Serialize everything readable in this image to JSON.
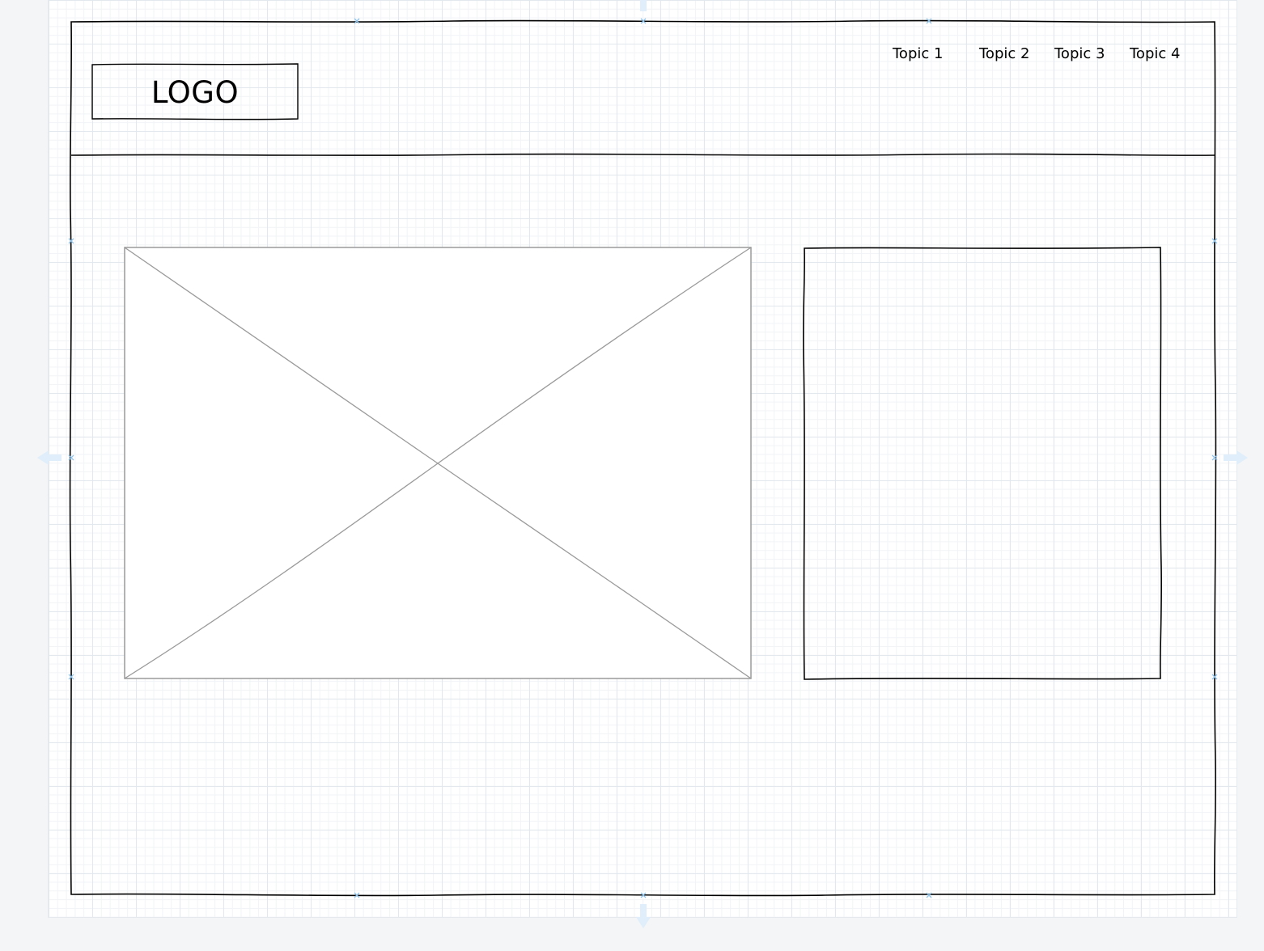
{
  "wireframe": {
    "logo": {
      "label": "LOGO"
    },
    "nav": {
      "topics": [
        "Topic 1",
        "Topic 2",
        "Topic 3",
        "Topic 4"
      ]
    }
  },
  "canvas": {
    "grid_color": "#e3e8ee",
    "handle_color": "#8fc3ea",
    "stroke_color": "#000000",
    "placeholder_stroke_color": "#9a9a9a"
  }
}
